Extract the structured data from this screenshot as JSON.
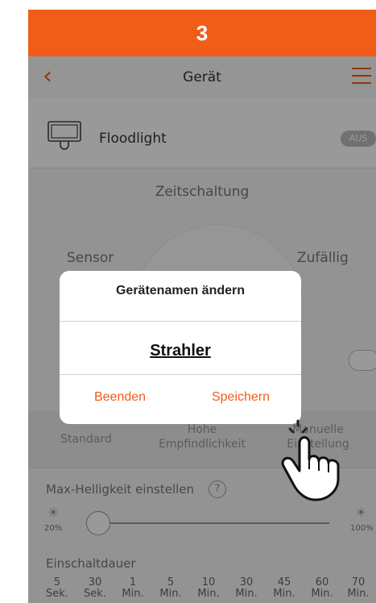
{
  "step": {
    "number": "3"
  },
  "nav": {
    "title": "Gerät",
    "back_icon": "chevron-left-icon",
    "menu_icon": "hamburger-menu-icon"
  },
  "device": {
    "name": "Floodlight",
    "status": "AUS",
    "icon": "floodlight-icon"
  },
  "timer": {
    "title": "Zeitschaltung",
    "mode_left": "Sensor",
    "mode_right": "Zufällig"
  },
  "sensitivity": {
    "tabs": [
      {
        "label": "Standard"
      },
      {
        "label": "Hohe Empfindlichkeit"
      },
      {
        "label": "Manuelle Einstellung"
      }
    ]
  },
  "brightness": {
    "label": "Max-Helligkeit einstellen",
    "help": "?",
    "min_label": "20%",
    "max_label": "100%",
    "value_percent": 20
  },
  "duration": {
    "label": "Einschaltdauer",
    "options": [
      {
        "value": "5",
        "unit": "Sek."
      },
      {
        "value": "30",
        "unit": "Sek."
      },
      {
        "value": "1",
        "unit": "Min."
      },
      {
        "value": "5",
        "unit": "Min."
      },
      {
        "value": "10",
        "unit": "Min."
      },
      {
        "value": "30",
        "unit": "Min."
      },
      {
        "value": "45",
        "unit": "Min."
      },
      {
        "value": "60",
        "unit": "Min."
      },
      {
        "value": "70",
        "unit": "Min."
      }
    ]
  },
  "dialog": {
    "title": "Gerätenamen ändern",
    "name_value": "Strahler",
    "cancel_label": "Beenden",
    "save_label": "Speichern"
  },
  "colors": {
    "accent": "#f25c19",
    "overlay": "rgba(0,0,0,0.4)"
  },
  "pointer": {
    "icon": "tap-hand-icon"
  }
}
